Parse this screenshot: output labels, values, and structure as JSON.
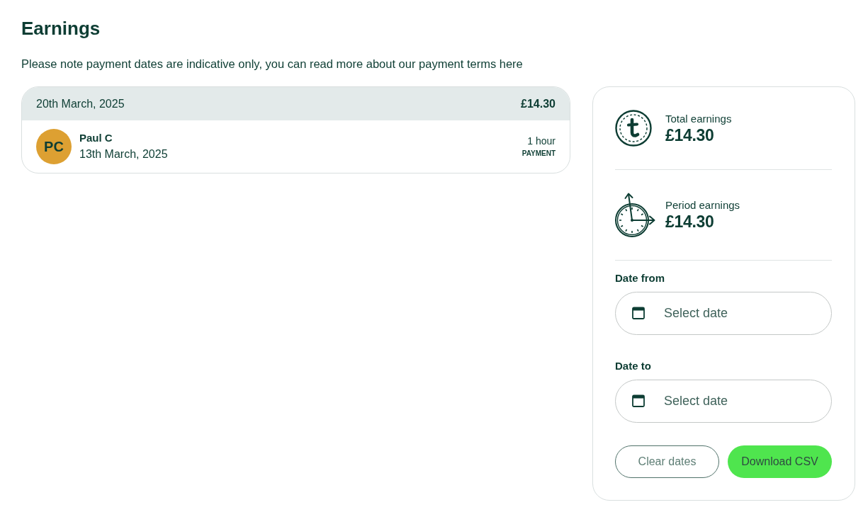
{
  "page": {
    "title": "Earnings",
    "notice": "Please note payment dates are indicative only, you can read more about our payment terms here"
  },
  "payouts": [
    {
      "date": "20th March, 2025",
      "amount": "£14.30",
      "items": [
        {
          "initials": "PC",
          "color": "#dda032",
          "name": "Paul C",
          "date": "13th March, 2025",
          "duration": "1 hour",
          "type": "PAYMENT"
        }
      ]
    }
  ],
  "summary": {
    "stats": [
      {
        "kind": "total",
        "label": "Total earnings",
        "amount": "£14.30"
      },
      {
        "kind": "period",
        "label": "Period earnings",
        "amount": "£14.30"
      }
    ],
    "date_fields": [
      {
        "label": "Date from",
        "placeholder": "Select date"
      },
      {
        "label": "Date to",
        "placeholder": "Select date"
      }
    ],
    "buttons": [
      {
        "kind": "outline",
        "label": "Clear dates"
      },
      {
        "kind": "primary",
        "label": "Download CSV"
      }
    ]
  }
}
